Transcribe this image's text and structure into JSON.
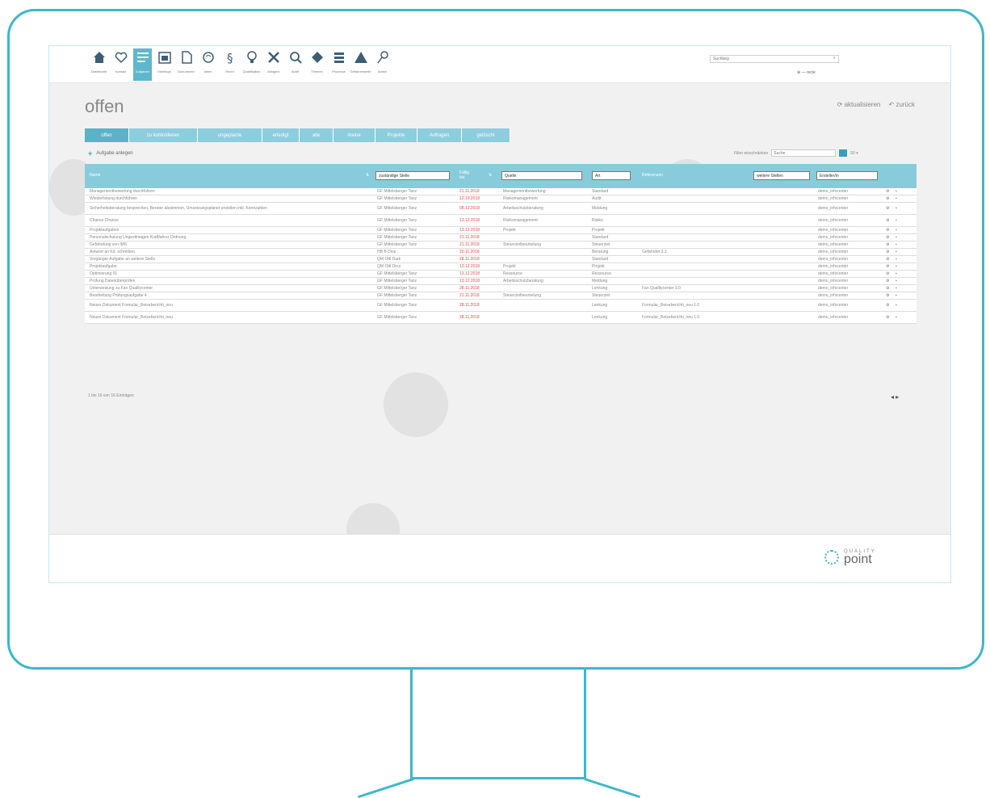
{
  "nav": {
    "items": [
      {
        "label": "Dashboard",
        "icon": "home-icon"
      },
      {
        "label": "Kontakt",
        "icon": "heart-icon"
      },
      {
        "label": "Aufgaben",
        "icon": "tasks-icon",
        "active": true
      },
      {
        "label": "Meetings",
        "icon": "calendar-icon"
      },
      {
        "label": "Dokumente",
        "icon": "document-icon"
      },
      {
        "label": "Ideen",
        "icon": "brain-icon"
      },
      {
        "label": "Recht",
        "icon": "paragraph-icon"
      },
      {
        "label": "Qualifikation",
        "icon": "bulb-icon"
      },
      {
        "label": "Anlagen",
        "icon": "tools-icon"
      },
      {
        "label": "Audit",
        "icon": "magnifier-icon"
      },
      {
        "label": "Themen",
        "icon": "diamond-icon"
      },
      {
        "label": "Prozesse",
        "icon": "process-icon"
      },
      {
        "label": "Gefahrenstelle",
        "icon": "warning-icon"
      },
      {
        "label": "Admin",
        "icon": "key-icon"
      }
    ]
  },
  "search": {
    "value": "Suchbeg"
  },
  "user": {
    "label": "⊕ — recie"
  },
  "page": {
    "title": "offen",
    "refresh_label": "aktualisieren",
    "back_label": "zurück"
  },
  "tabs": [
    "offen",
    "zu kontrollieren",
    "ungeplante",
    "erledigt",
    "alle",
    "meine",
    "Projekte",
    "Anfragen",
    "gelöscht"
  ],
  "toolbar": {
    "add_task_label": "Aufgabe anlegen",
    "filter_label": "Filter einschränken",
    "filter_value": "Suche",
    "count_label": "50 ▾"
  },
  "table": {
    "headers": {
      "name": "Name",
      "responsible": "zuständige Stelle",
      "due": "Fällig bis",
      "source": "Quelle",
      "type": "Art",
      "reference": "Referenzen",
      "person": "weitere Stellen",
      "creator": "Ersteller/in"
    },
    "rows": [
      {
        "name": "Managementbewertung durchführen",
        "resp": "GF Mittelsberger Tanz",
        "due": "21.11.2018",
        "source": "Managementbewertung",
        "type": "Standard",
        "ref": "",
        "creator": "demo_infocenter"
      },
      {
        "name": "Wiederholung durchführen",
        "resp": "GF Mittelsberger Tanz",
        "due": "12.10.2018",
        "source": "Risikomanagement",
        "type": "Audit",
        "ref": "",
        "creator": "demo_infocenter"
      },
      {
        "name": "Sicherheitsberatung besprechen, Berater abstimmen, Umsetzungsplaner erstellen inkl. Kennzahlen",
        "resp": "GF Mittelsberger Tanz",
        "due": "08.12.2018",
        "source": "Arbeitsschutzberatung",
        "type": "Meldung",
        "ref": "",
        "creator": "demo_infocenter",
        "tall": true
      },
      {
        "name": "Chance Chance",
        "resp": "GF Mittelsberger Tanz",
        "due": "13.12.2018",
        "source": "Risikomanagement",
        "type": "Risiko",
        "ref": "",
        "creator": "demo_infocenter",
        "tall": true
      },
      {
        "name": "Projektaufgaben",
        "resp": "GF Mittelsberger Tanz",
        "due": "13.12.2018",
        "source": "Projekt",
        "type": "Projekt",
        "ref": "",
        "creator": "demo_infocenter"
      },
      {
        "name": "Personalschulung Ungestimagen Kraftfahrer Ordnung",
        "resp": "GF Mittelsberger Tanz",
        "due": "21.11.2018",
        "source": "",
        "type": "Standard",
        "ref": "",
        "creator": "demo_infocenter"
      },
      {
        "name": "Gefährdung von IMS",
        "resp": "GF Mittelsberger Tanz",
        "due": "21.11.2018",
        "source": "Steuerzielbeurteilung",
        "type": "Steuerziel",
        "ref": "",
        "creator": "demo_infocenter"
      },
      {
        "name": "Antwort an Kd. schreiben",
        "resp": "HB B Dirui",
        "due": "20.11.2018",
        "source": "",
        "type": "Beratung",
        "ref": "Gefährdet 3.1",
        "creator": "demo_infocenter"
      },
      {
        "name": "Vorgänger Aufgabe an weitere Stelle",
        "resp": "QM Ottl Dark",
        "due": "28.11.2018",
        "source": "",
        "type": "Standard",
        "ref": "",
        "creator": "demo_infocenter"
      },
      {
        "name": "Projektaufgabe",
        "resp": "QM Ottl Dirui",
        "due": "13.12.2018",
        "source": "Projekt",
        "type": "Projekt",
        "ref": "",
        "creator": "demo_infocenter"
      },
      {
        "name": "Optimierung 01",
        "resp": "GF Mittelsberger Tanz",
        "due": "13.12.2018",
        "source": "Ressource",
        "type": "Ressource",
        "ref": "",
        "creator": "demo_infocenter"
      },
      {
        "name": "Prüfung Datenüberprüfen",
        "resp": "GF Mittelsberger Tanz",
        "due": "13.12.2018",
        "source": "Arbeitsschutzberatung",
        "type": "Meldung",
        "ref": "",
        "creator": "demo_infocenter"
      },
      {
        "name": "Unterweisung zu Fan Qualitycenter",
        "resp": "GF Mittelsberger Tanz",
        "due": "28.11.2018",
        "source": "",
        "type": "Lenkung",
        "ref": "Fan Qualitycenter 3.0",
        "creator": "demo_infocenter"
      },
      {
        "name": "Bearbeitung Prüfungsaufgabe 4",
        "resp": "GF Mittelsberger Tanz",
        "due": "21.11.2018",
        "source": "Steuerzielbeurteilung",
        "type": "Steuerziel",
        "ref": "",
        "creator": "demo_infocenter"
      },
      {
        "name": "Neues Dokument Formular_Reiseberichti_neu",
        "resp": "GF Mittelsberger Tanz",
        "due": "28.11.2018",
        "source": "",
        "type": "Lenkung",
        "ref": "Formular_Reiseberichti_neu 1.0",
        "creator": "demo_infocenter",
        "tall": true
      },
      {
        "name": "Neues Dokument Formular_Reiseberichti_neu",
        "resp": "GF Mittelsberger Tanz",
        "due": "28.11.2018",
        "source": "",
        "type": "Lenkung",
        "ref": "Formular_Reiseberichti_neu 1.0",
        "creator": "demo_infocenter",
        "tall": true
      }
    ]
  },
  "footer": {
    "count_note": "1 bis 16 von 16 Einträgen",
    "pager": "◂ ▸"
  },
  "brand": {
    "line1": "QUALITY",
    "line2": "point"
  }
}
